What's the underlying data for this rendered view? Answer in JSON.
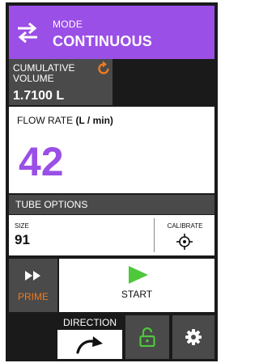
{
  "mode": {
    "label": "MODE",
    "value": "CONTINUOUS",
    "icon": "swap-arrows-icon"
  },
  "cumulative": {
    "label": "CUMULATIVE VOLUME",
    "value": "1.7100 L",
    "icon": "reset-icon"
  },
  "flow_rate": {
    "label": "FLOW RATE",
    "unit": "(L / min)",
    "value": "42"
  },
  "tube_options": {
    "header": "TUBE OPTIONS",
    "size_label": "SIZE",
    "size_value": "91",
    "calibrate_label": "CALIBRATE",
    "calibrate_icon": "crosshair-target-icon"
  },
  "prime": {
    "label": "PRIME",
    "icon": "fast-forward-icon"
  },
  "start": {
    "label": "START",
    "icon": "play-icon"
  },
  "direction": {
    "label": "DIRECTION",
    "icon": "clockwise-arrow-icon"
  },
  "lock": {
    "icon": "unlocked-padlock-icon"
  },
  "settings": {
    "icon": "gear-icon"
  },
  "colors": {
    "accent_purple": "#9a4fe6",
    "panel_gray": "#4a4a4a",
    "background": "#1a1a1a",
    "orange": "#ee7a1f",
    "green": "#4ec83b"
  }
}
